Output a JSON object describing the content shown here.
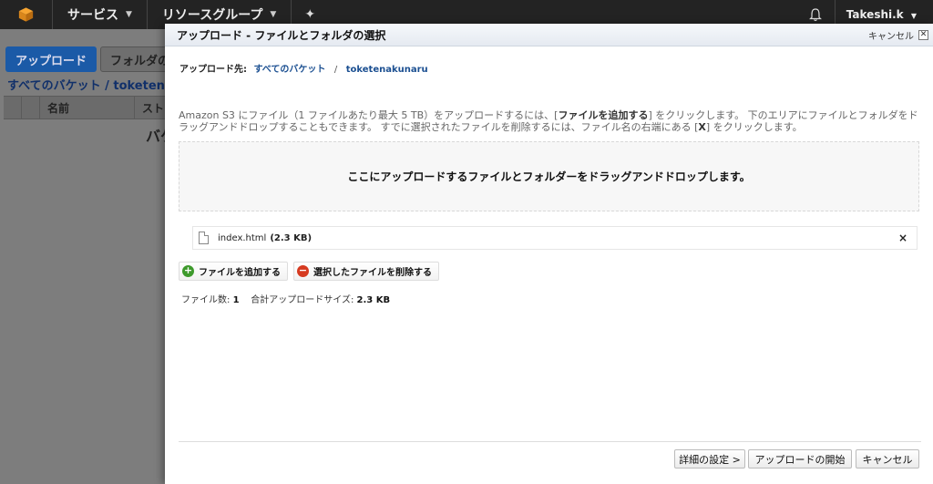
{
  "topnav": {
    "services": "サービス",
    "resource_groups": "リソースグループ",
    "user": "Takeshi.k"
  },
  "bg": {
    "upload_button": "アップロード",
    "folder_button": "フォルダの",
    "breadcrumb": "すべてのバケット / toketen",
    "col_name": "名前",
    "col_storage": "スト",
    "empty_text": "バケ"
  },
  "dialog": {
    "title": "アップロード - ファイルとフォルダの選択",
    "cancel_top": "キャンセル",
    "dest_label": "アップロード先:",
    "dest_all": "すべてのバケット",
    "dest_sep": "/",
    "dest_bucket": "toketenakunaru",
    "info_pre": "Amazon S3 にファイル（1 ファイルあたり最大 5 TB）をアップロードするには、[",
    "info_add": "ファイルを追加する",
    "info_mid": "] をクリックします。 下のエリアにファイルとフォルダをドラッグアンドドロップすることもできます。 すでに選択されたファイルを削除するには、ファイル名の右端にある [",
    "info_x": "X",
    "info_post": "] をクリックします。",
    "dropzone": "ここにアップロードするファイルとフォルダーをドラッグアンドドロップします。",
    "file_name": "index.html",
    "file_size": "(2.3 KB)",
    "remove": "×",
    "add_files": "ファイルを追加する",
    "delete_selected": "選択したファイルを削除する",
    "files_label": "ファイル数:",
    "files_count": "1",
    "total_label": "合計アップロードサイズ:",
    "total_size": "2.3 KB",
    "btn_detail": "詳細の設定 >",
    "btn_start": "アップロードの開始",
    "btn_cancel": "キャンセル"
  }
}
